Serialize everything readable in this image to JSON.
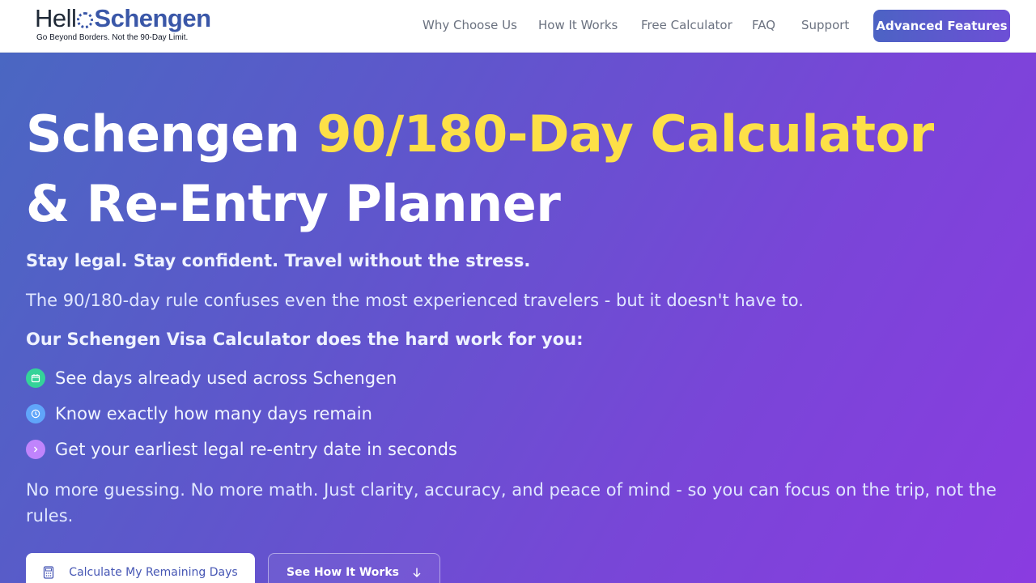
{
  "brand": {
    "name_part1": "Hell",
    "name_part2": "Schengen",
    "tagline": "Go Beyond Borders. Not the 90-Day Limit."
  },
  "nav": {
    "links": [
      "Why Choose Us",
      "How It Works",
      "Free Calculator",
      "FAQ",
      "Support"
    ],
    "cta": "Advanced Features"
  },
  "hero": {
    "title_part1": "Schengen ",
    "title_accent": "90/180-Day Calculator",
    "title_part2": "& Re-Entry Planner",
    "tagline": "Stay legal. Stay confident. Travel without the stress.",
    "intro": "The 90/180-day rule confuses even the most experienced travelers - but it doesn't have to.",
    "lead": "Our Schengen Visa Calculator does the hard work for you:",
    "features": [
      {
        "text": "See days already used across Schengen",
        "icon": "calendar-icon",
        "color": "#34d399"
      },
      {
        "text": "Know exactly how many days remain",
        "icon": "clock-icon",
        "color": "#60a5fa"
      },
      {
        "text": "Get your earliest legal re-entry date in seconds",
        "icon": "chevron-right-icon",
        "color": "#c084fc"
      }
    ],
    "closing": "No more guessing. No more math. Just clarity, accuracy, and peace of mind - so you can focus on the trip, not the rules.",
    "primary_button": "Calculate My Remaining Days",
    "secondary_button": "See How It Works"
  },
  "colors": {
    "accent": "#fde047",
    "brand_blue": "#3a57a8"
  }
}
